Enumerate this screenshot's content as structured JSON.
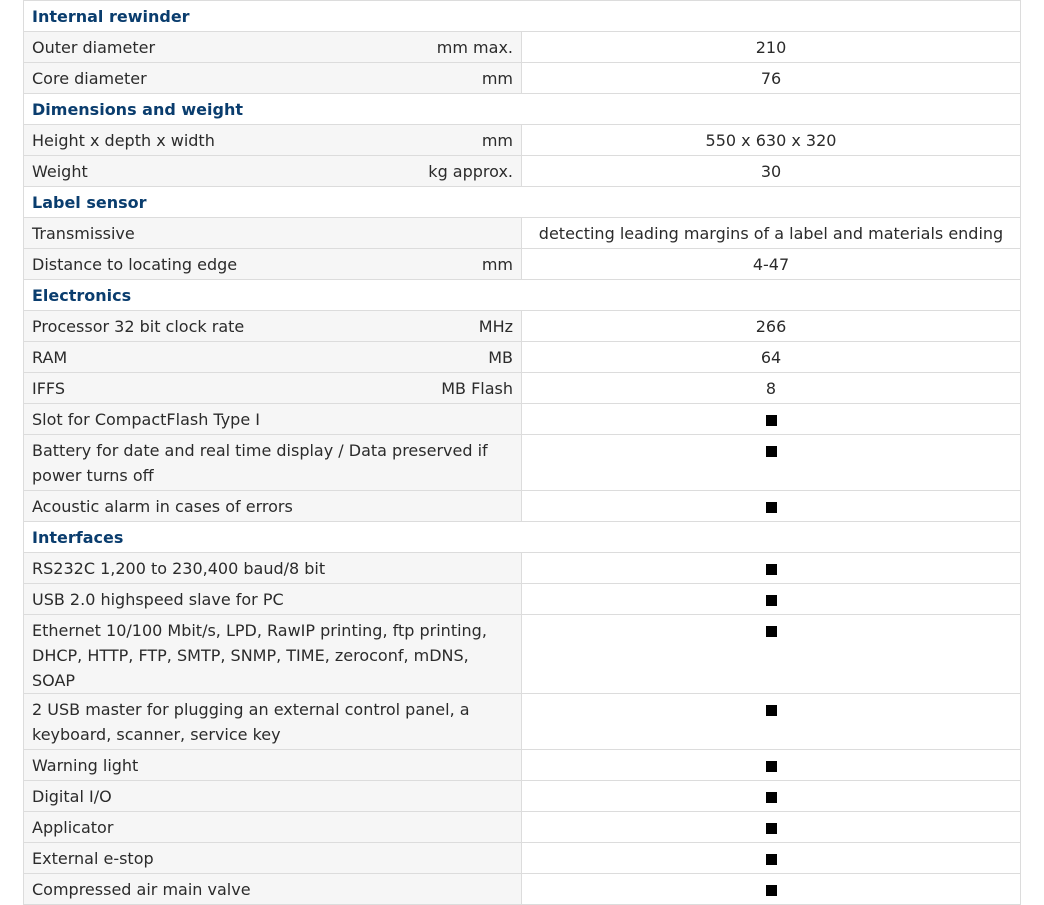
{
  "sections": [
    {
      "title": "Internal rewinder",
      "rows": [
        {
          "label": "Outer diameter",
          "unit": "mm max.",
          "value": "210"
        },
        {
          "label": "Core diameter",
          "unit": "mm",
          "value": "76"
        }
      ]
    },
    {
      "title": "Dimensions and weight",
      "rows": [
        {
          "label": "Height x depth x width",
          "unit": "mm",
          "value": "550 x 630 x 320"
        },
        {
          "label": "Weight",
          "unit": "kg approx.",
          "value": "30"
        }
      ]
    },
    {
      "title": "Label sensor",
      "rows": [
        {
          "label": "Transmissive",
          "unit": "",
          "value": "detecting leading margins of a label and materials ending"
        },
        {
          "label": "Distance to locating edge",
          "unit": "mm",
          "value": "4-47"
        }
      ]
    },
    {
      "title": "Electronics",
      "rows": [
        {
          "label": "Processor 32 bit clock rate",
          "unit": "MHz",
          "value": "266"
        },
        {
          "label": "RAM",
          "unit": "MB",
          "value": "64"
        },
        {
          "label": "IFFS",
          "unit": "MB Flash",
          "value": "8"
        },
        {
          "label": "Slot for CompactFlash Type I",
          "unit": "",
          "value": "■"
        },
        {
          "label": "Battery for date and real time display / Data preserved if power turns off",
          "unit": "",
          "value": "■"
        },
        {
          "label": "Acoustic alarm in cases of errors",
          "unit": "",
          "value": "■"
        }
      ]
    },
    {
      "title": "Interfaces",
      "rows": [
        {
          "label": "RS232C 1,200 to 230,400 baud/8 bit",
          "unit": "",
          "value": "■"
        },
        {
          "label": "USB 2.0 highspeed slave for PC",
          "unit": "",
          "value": "■"
        },
        {
          "label": "Ethernet 10/100 Mbit/s, LPD, RawIP printing, ftp printing, DHCP, HTTP, FTP, SMTP, SNMP, TIME, zeroconf, mDNS, SOAP",
          "unit": "",
          "value": "■"
        },
        {
          "label": "2 USB master for plugging an external control panel, a keyboard, scanner, service key",
          "unit": "",
          "value": "■"
        },
        {
          "label": "Warning light",
          "unit": "",
          "value": "■"
        },
        {
          "label": "Digital I/O",
          "unit": "",
          "value": "■"
        },
        {
          "label": "Applicator",
          "unit": "",
          "value": "■"
        },
        {
          "label": "External e-stop",
          "unit": "",
          "value": "■"
        },
        {
          "label": "Compressed air main valve",
          "unit": "",
          "value": "■"
        }
      ]
    }
  ],
  "colors": {
    "section_title": "#0a3d6e",
    "label_background": "#f6f6f6",
    "border": "#dcdcdc",
    "bullet": "#000000"
  }
}
